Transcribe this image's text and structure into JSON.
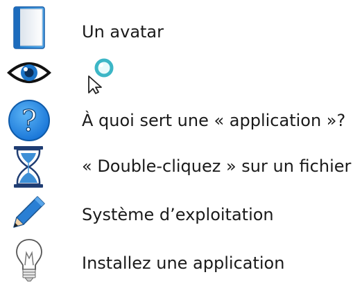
{
  "items": [
    {
      "icon": "book-icon",
      "label": "Un avatar"
    },
    {
      "icon": "eye-icon",
      "label": ""
    },
    {
      "icon": "question-icon",
      "label": "À quoi sert une « application »?"
    },
    {
      "icon": "hourglass-icon",
      "label": "« Double-cliquez » sur un fichier"
    },
    {
      "icon": "pencil-icon",
      "label": "Système d’exploitation"
    },
    {
      "icon": "lightbulb-icon",
      "label": "Installez une application"
    }
  ],
  "extra_icons": [
    "cursor-magnifier-icon"
  ],
  "colors": {
    "book_blue": "#2a8ad8",
    "question_blue": "#1e8fe6",
    "eye_blue": "#1b74c8",
    "hourglass_navy": "#1f3d73",
    "sand_blue": "#3d8fd6",
    "pencil_blue": "#2a7fd4",
    "text": "#1a1a1a"
  }
}
